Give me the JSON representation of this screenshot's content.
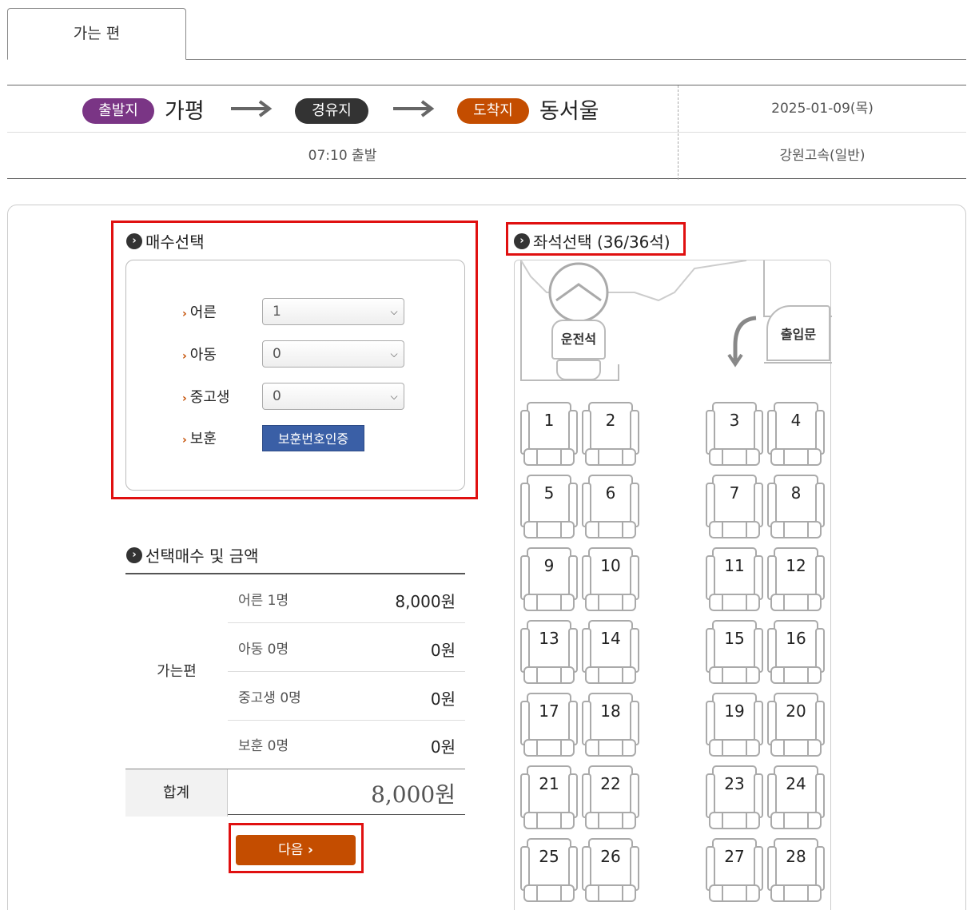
{
  "tab": {
    "label": "가는 편"
  },
  "route": {
    "departure_badge": "출발지",
    "departure": "가평",
    "via_badge": "경유지",
    "arrival_badge": "도착지",
    "arrival": "동서울",
    "date": "2025-01-09(목)",
    "depart_time": "07:10 출발",
    "company": "강원고속(일반)"
  },
  "quantity": {
    "title": "매수선택",
    "rows": [
      {
        "label": "어른",
        "value": "1"
      },
      {
        "label": "아동",
        "value": "0"
      },
      {
        "label": "중고생",
        "value": "0"
      }
    ],
    "veteran_label": "보훈",
    "veteran_button": "보훈번호인증"
  },
  "summary": {
    "title": "선택매수 및 금액",
    "route_label": "가는편",
    "lines": [
      {
        "label": "어른 1명",
        "amount": "8,000원"
      },
      {
        "label": "아동 0명",
        "amount": "0원"
      },
      {
        "label": "중고생 0명",
        "amount": "0원"
      },
      {
        "label": "보훈 0명",
        "amount": "0원"
      }
    ],
    "total_label": "합계",
    "total_amount": "8,000원"
  },
  "next_button": "다음",
  "seat": {
    "title": "좌석선택 (36/36석)",
    "driver_label": "운전석",
    "door_label": "출입문",
    "seats": [
      "1",
      "2",
      "3",
      "4",
      "5",
      "6",
      "7",
      "8",
      "9",
      "10",
      "11",
      "12",
      "13",
      "14",
      "15",
      "16",
      "17",
      "18",
      "19",
      "20",
      "21",
      "22",
      "23",
      "24",
      "25",
      "26",
      "27",
      "28"
    ]
  },
  "colors": {
    "departure": "#7a3585",
    "via": "#333333",
    "arrival": "#c44d00",
    "accent": "#c44d00",
    "highlight": "#e01010",
    "blue_button": "#3a5fa6"
  }
}
